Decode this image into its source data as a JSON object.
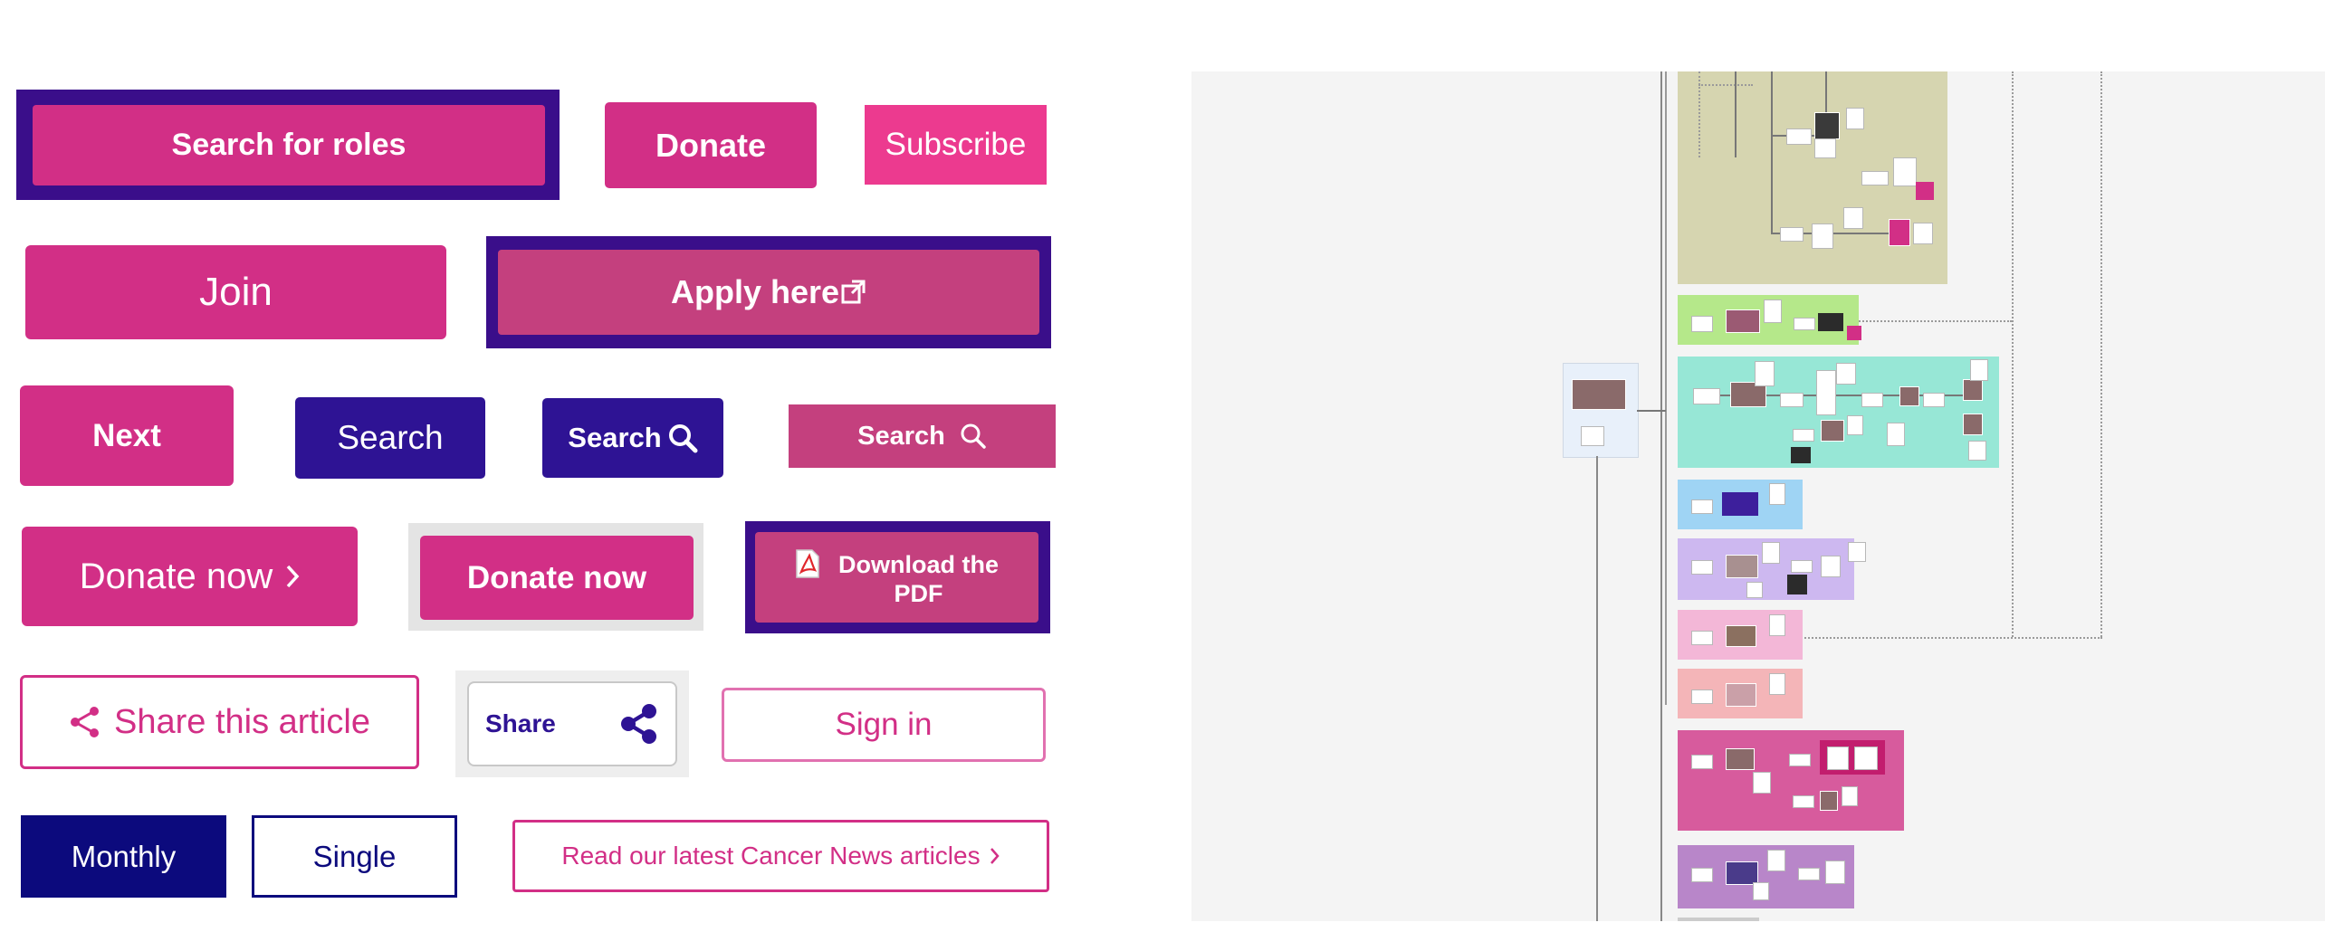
{
  "buttons": {
    "search_for_roles": "Search for roles",
    "donate": "Donate",
    "subscribe": "Subscribe",
    "join": "Join",
    "apply_here": "Apply here",
    "next": "Next",
    "search_1": "Search",
    "search_2": "Search",
    "search_3": "Search",
    "donate_now_arrow": "Donate now",
    "donate_now": "Donate now",
    "download_pdf_line1": "Download the",
    "download_pdf_line2": "PDF",
    "share_this_article": "Share this article",
    "share": "Share",
    "sign_in": "Sign in",
    "monthly": "Monthly",
    "single": "Single",
    "read_latest": "Read our latest Cancer News articles"
  },
  "colors": {
    "brand_pink": "#d22f86",
    "hot_pink": "#ec3a8f",
    "muted_pink": "#c4407e",
    "deep_purple": "#2e1394",
    "navy": "#0c0a7d",
    "frame_purple": "#3a0e8a"
  },
  "icons": {
    "external_link": "external-link-icon",
    "magnifier": "search-icon",
    "chevron": "chevron-right-icon",
    "pdf": "pdf-file-icon",
    "share": "share-icon"
  },
  "flow_panel": {
    "sections": [
      "olive",
      "lime",
      "teal",
      "light-blue",
      "lavender",
      "light-pink",
      "salmon",
      "magenta",
      "purple"
    ]
  }
}
